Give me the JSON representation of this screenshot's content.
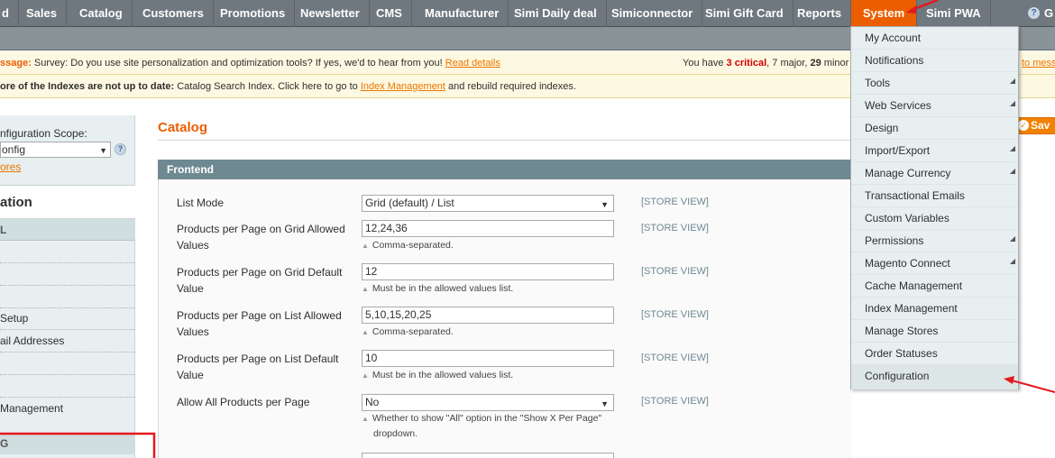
{
  "nav": {
    "items": [
      {
        "label": "d",
        "left": 0,
        "active": false
      },
      {
        "label": "Sales"
      },
      {
        "label": "Catalog"
      },
      {
        "label": "Customers"
      },
      {
        "label": "Promotions"
      },
      {
        "label": "Newsletter"
      },
      {
        "label": "CMS"
      },
      {
        "label": "Manufacturer"
      },
      {
        "label": "Simi Daily deal"
      },
      {
        "label": "Simiconnector"
      },
      {
        "label": "Simi Gift Card"
      },
      {
        "label": "Reports"
      },
      {
        "label": "System"
      },
      {
        "label": "Simi PWA"
      }
    ],
    "help_icon": "?",
    "help_text": "G"
  },
  "messages": {
    "line1_prefix": "ssage:",
    "line1_text": " Survey: Do you use site personalization and optimization tools? If yes, we'd to hear from you! ",
    "line1_link": "Read details",
    "line1_right_a": "You have ",
    "line1_critical_count": "3 critical",
    "line1_right_b": ", 7 major, ",
    "line1_minor": "29",
    "line1_right_c": " minor a",
    "line1_right_link": "to mess",
    "line2_strong": "ore of the Indexes are not up to date:",
    "line2_text": " Catalog Search Index. Click here to go to ",
    "line2_link": "Index Management",
    "line2_tail": " and rebuild required indexes."
  },
  "sidebar": {
    "scope_label": "nfiguration Scope:",
    "scope_value": "onfig",
    "scope_help": "?",
    "manage_stores": "ores",
    "title": "ation",
    "group1": "L",
    "items": [
      "",
      "",
      "",
      "Setup",
      "ail Addresses",
      "",
      "",
      "Management"
    ],
    "group2": "G"
  },
  "main": {
    "section_title": "Catalog",
    "save_label": "Sav",
    "fieldset_title": "Frontend",
    "fields": [
      {
        "label": "List Mode",
        "value": "Grid (default) / List",
        "type": "select",
        "note": "",
        "scope": "[STORE VIEW]"
      },
      {
        "label": "Products per Page on Grid Allowed Values",
        "value": "12,24,36",
        "type": "input",
        "note": "Comma-separated.",
        "scope": "[STORE VIEW]"
      },
      {
        "label": "Products per Page on Grid Default Value",
        "value": "12",
        "type": "input",
        "note": "Must be in the allowed values list.",
        "scope": "[STORE VIEW]"
      },
      {
        "label": "Products per Page on List Allowed Values",
        "value": "5,10,15,20,25",
        "type": "input",
        "note": "Comma-separated.",
        "scope": "[STORE VIEW]"
      },
      {
        "label": "Products per Page on List Default Value",
        "value": "10",
        "type": "input",
        "note": "Must be in the allowed values list.",
        "scope": "[STORE VIEW]"
      },
      {
        "label": "Allow All Products per Page",
        "value": "No",
        "type": "select",
        "note": "Whether to show \"All\" option in the \"Show X Per Page\"",
        "note2": "dropdown.",
        "scope": "[STORE VIEW]"
      }
    ]
  },
  "dropdown": {
    "items": [
      {
        "label": "My Account",
        "sub": false
      },
      {
        "label": "Notifications",
        "sub": false
      },
      {
        "label": "Tools",
        "sub": true
      },
      {
        "label": "Web Services",
        "sub": true
      },
      {
        "label": "Design",
        "sub": false
      },
      {
        "label": "Import/Export",
        "sub": true
      },
      {
        "label": "Manage Currency",
        "sub": true
      },
      {
        "label": "Transactional Emails",
        "sub": false
      },
      {
        "label": "Custom Variables",
        "sub": false
      },
      {
        "label": "Permissions",
        "sub": true
      },
      {
        "label": "Magento Connect",
        "sub": true
      },
      {
        "label": "Cache Management",
        "sub": false
      },
      {
        "label": "Index Management",
        "sub": false
      },
      {
        "label": "Manage Stores",
        "sub": false
      },
      {
        "label": "Order Statuses",
        "sub": false
      },
      {
        "label": "Configuration",
        "sub": false
      }
    ]
  },
  "colors": {
    "nav_bg": "#6f787e",
    "active_tab": "#eb5e00",
    "accent": "#eb5e00",
    "annotation": "#e4181e"
  }
}
